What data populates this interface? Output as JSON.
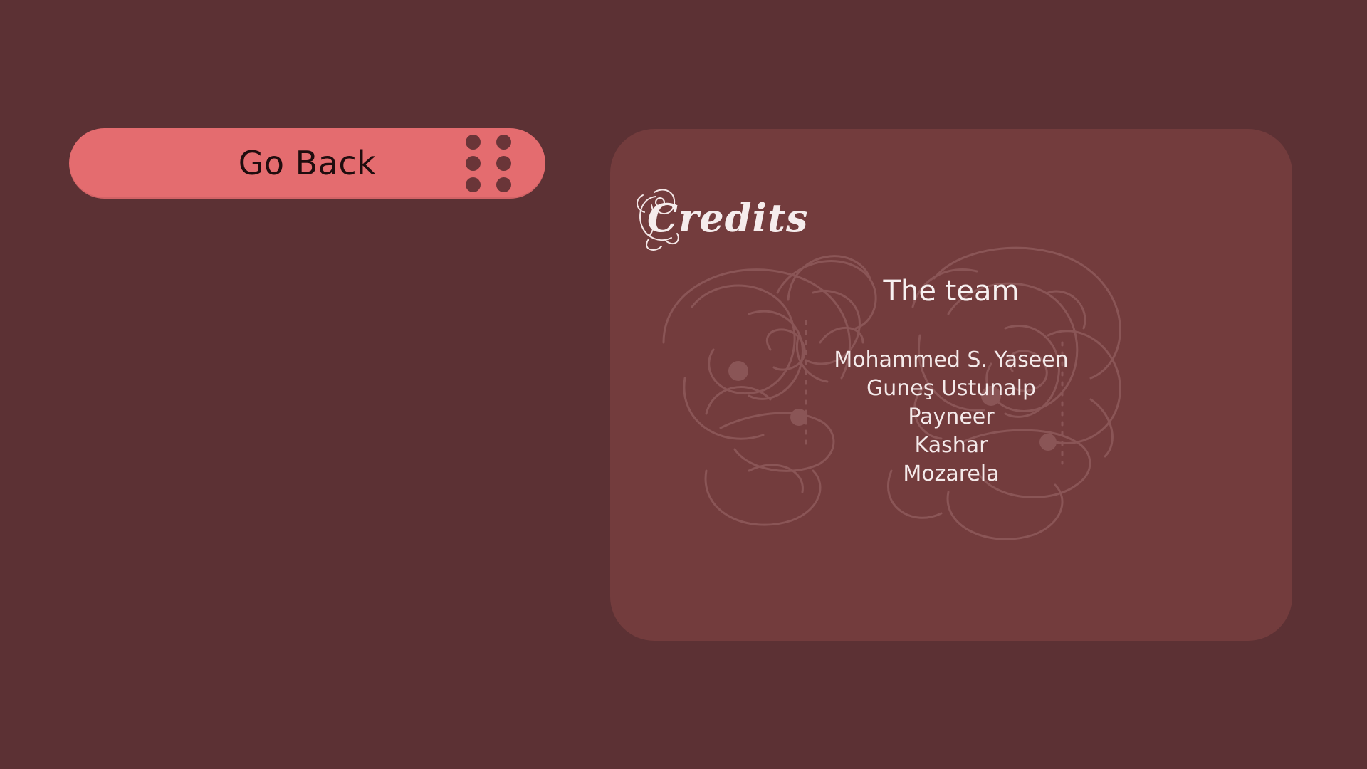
{
  "toolbar": {
    "go_back_label": "Go Back"
  },
  "credits": {
    "title": "Credits",
    "team_heading": "The team",
    "members": [
      "Mohammed S. Yaseen",
      "Guneş Ustunalp",
      "Payneer",
      "Kashar",
      "Mozarela"
    ]
  },
  "colors": {
    "background": "#5c3134",
    "button": "#e46c6f",
    "panel": "#733c3d",
    "text_light": "#f4eaea"
  },
  "icons": {
    "grip": "drag-handle-icon",
    "ornament": "calligraphic-ornament-icon"
  }
}
